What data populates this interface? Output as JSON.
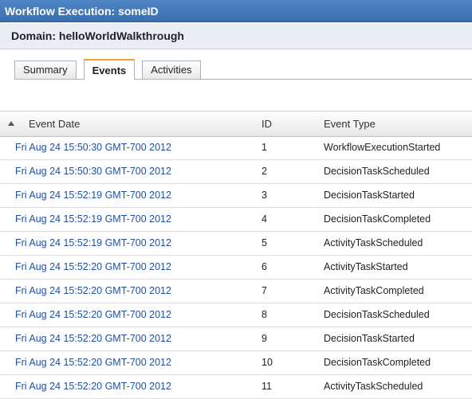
{
  "window": {
    "title": "Workflow Execution: someID"
  },
  "domain": {
    "label": "Domain: helloWorldWalkthrough"
  },
  "tabs": [
    {
      "label": "Summary",
      "active": false
    },
    {
      "label": "Events",
      "active": true
    },
    {
      "label": "Activities",
      "active": false
    }
  ],
  "table": {
    "sort": {
      "column": "Event Date",
      "direction": "ascending",
      "icon": "sort-ascending-icon"
    },
    "headers": {
      "date": "Event Date",
      "id": "ID",
      "type": "Event Type"
    },
    "rows": [
      {
        "date": "Fri Aug 24 15:50:30 GMT-700 2012",
        "id": "1",
        "type": "WorkflowExecutionStarted"
      },
      {
        "date": "Fri Aug 24 15:50:30 GMT-700 2012",
        "id": "2",
        "type": "DecisionTaskScheduled"
      },
      {
        "date": "Fri Aug 24 15:52:19 GMT-700 2012",
        "id": "3",
        "type": "DecisionTaskStarted"
      },
      {
        "date": "Fri Aug 24 15:52:19 GMT-700 2012",
        "id": "4",
        "type": "DecisionTaskCompleted"
      },
      {
        "date": "Fri Aug 24 15:52:19 GMT-700 2012",
        "id": "5",
        "type": "ActivityTaskScheduled"
      },
      {
        "date": "Fri Aug 24 15:52:20 GMT-700 2012",
        "id": "6",
        "type": "ActivityTaskStarted"
      },
      {
        "date": "Fri Aug 24 15:52:20 GMT-700 2012",
        "id": "7",
        "type": "ActivityTaskCompleted"
      },
      {
        "date": "Fri Aug 24 15:52:20 GMT-700 2012",
        "id": "8",
        "type": "DecisionTaskScheduled"
      },
      {
        "date": "Fri Aug 24 15:52:20 GMT-700 2012",
        "id": "9",
        "type": "DecisionTaskStarted"
      },
      {
        "date": "Fri Aug 24 15:52:20 GMT-700 2012",
        "id": "10",
        "type": "DecisionTaskCompleted"
      },
      {
        "date": "Fri Aug 24 15:52:20 GMT-700 2012",
        "id": "11",
        "type": "ActivityTaskScheduled"
      }
    ]
  },
  "colors": {
    "titlebar": "#3a6fb0",
    "link": "#1f4f9e",
    "active_tab_accent": "#f0a030"
  }
}
